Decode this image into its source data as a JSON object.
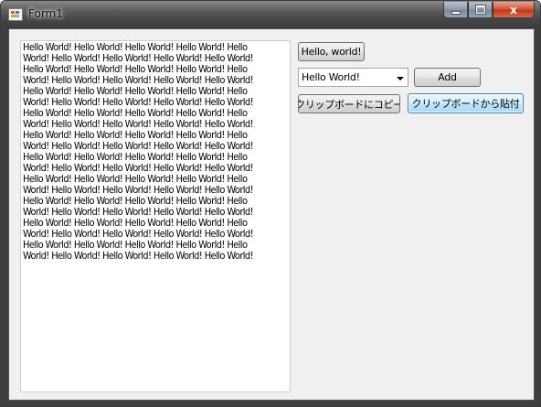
{
  "window": {
    "title": "Form1",
    "icon": "app-form-icon",
    "controls": {
      "minimize_icon": "minimize-icon",
      "maximize_icon": "maximize-icon",
      "close_glyph": "x"
    }
  },
  "textbox": {
    "lines": [
      "Hello World! Hello World! Hello World! Hello World! Hello",
      "World! Hello World! Hello World! Hello World! Hello World!",
      "Hello World! Hello World! Hello World! Hello World! Hello",
      "World! Hello World! Hello World! Hello World! Hello World!",
      "Hello World! Hello World! Hello World! Hello World! Hello",
      "World! Hello World! Hello World! Hello World! Hello World!",
      "Hello World! Hello World! Hello World! Hello World! Hello",
      "World! Hello World! Hello World! Hello World! Hello World!",
      "Hello World! Hello World! Hello World! Hello World! Hello",
      "World! Hello World! Hello World! Hello World! Hello World!",
      "Hello World! Hello World! Hello World! Hello World! Hello",
      "World! Hello World! Hello World! Hello World! Hello World!",
      "Hello World! Hello World! Hello World! Hello World! Hello",
      "World! Hello World! Hello World! Hello World! Hello World!",
      "Hello World! Hello World! Hello World! Hello World! Hello",
      "World! Hello World! Hello World! Hello World! Hello World!",
      "Hello World! Hello World! Hello World! Hello World! Hello",
      "World! Hello World! Hello World! Hello World! Hello World!",
      "Hello World! Hello World! Hello World! Hello World! Hello",
      "World! Hello World! Hello World! Hello World! Hello World!"
    ]
  },
  "buttons": {
    "hello": "Hello, world!",
    "add": "Add",
    "copy": "クリップボードにコピー",
    "paste": "クリップボードから貼付"
  },
  "combo": {
    "selected": "Hello World!",
    "arrow_icon": "chevron-down-icon"
  },
  "colors": {
    "titlebar": "#4a4a4a",
    "client_bg": "#f0f0f0",
    "close_button": "#c1391b",
    "focus_border": "#3c7fb1"
  }
}
